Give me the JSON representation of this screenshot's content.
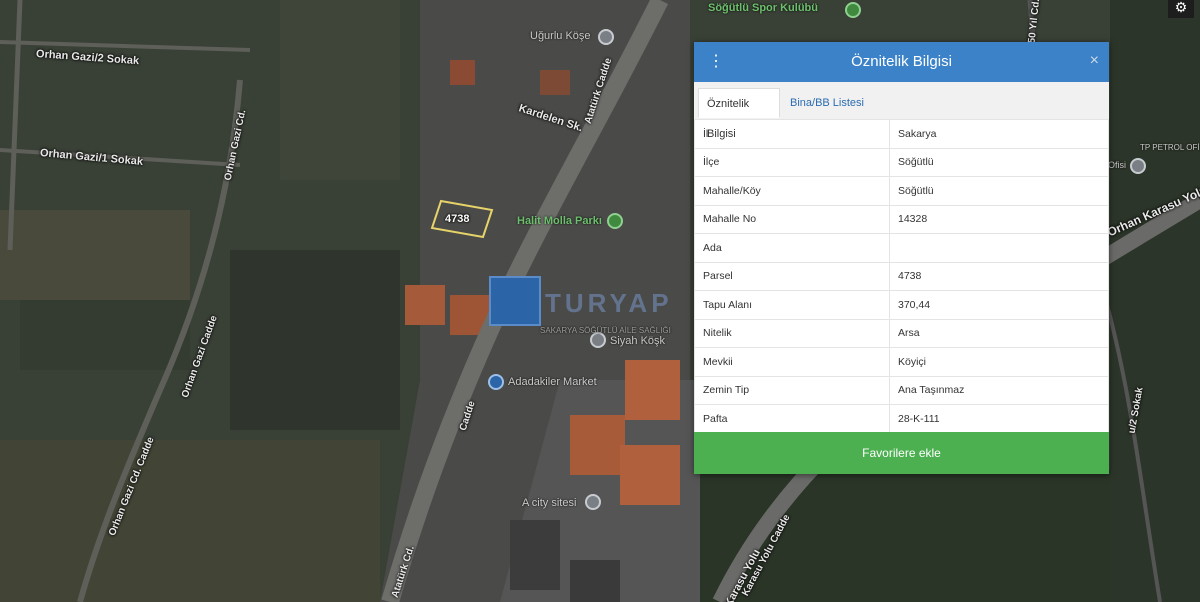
{
  "map": {
    "parcel_number": "4738",
    "street_labels": [
      "Orhan Gazi/2 Sokak",
      "Orhan Gazi/1 Sokak",
      "Orhan Gazi Cd.",
      "Orhan Gazi Cadde",
      "Orhan Gazi Cd. Cadde",
      "Kardelen Sk.",
      "Atatürk Cadde",
      "Atatürk Cd.",
      "Cadde",
      "Karasu Yolu Cadde",
      "Karasu Yolu",
      "Orhan Karasu Yolu",
      "u/2 Sokak",
      "50 Yıl Cd."
    ],
    "pois": [
      "Uğurlu Köşe",
      "Halit Molla Parkı",
      "Söğütlü Spor Kulübü",
      "Adadakiler Market",
      "Siyah Köşk",
      "A city sitesi",
      "SAKARYA SÖĞÜTLÜ AİLE SAĞLIĞI",
      "TP PETROL OFİSİ",
      "Ofisi"
    ],
    "watermark": "TURYAP"
  },
  "panel": {
    "title": "Öznitelik Bilgisi",
    "close_label": "×",
    "menu_label": "⋮",
    "tabs": [
      {
        "label": "Öznitelik Bilgisi"
      },
      {
        "label": "Bina/BB Listesi"
      }
    ],
    "rows": [
      {
        "key": "İl",
        "value": "Sakarya"
      },
      {
        "key": "İlçe",
        "value": "Söğütlü"
      },
      {
        "key": "Mahalle/Köy",
        "value": "Söğütlü"
      },
      {
        "key": "Mahalle No",
        "value": "14328"
      },
      {
        "key": "Ada",
        "value": ""
      },
      {
        "key": "Parsel",
        "value": "4738"
      },
      {
        "key": "Tapu Alanı",
        "value": "370,44"
      },
      {
        "key": "Nitelik",
        "value": "Arsa"
      },
      {
        "key": "Mevkii",
        "value": "Köyiçi"
      },
      {
        "key": "Zemin Tip",
        "value": "Ana Taşınmaz"
      },
      {
        "key": "Pafta",
        "value": "28-K-111"
      }
    ],
    "favorite_button": "Favorilere ekle"
  },
  "colors": {
    "header": "#3c82c8",
    "button": "#4caf50",
    "tab_link": "#2b6cb0"
  }
}
